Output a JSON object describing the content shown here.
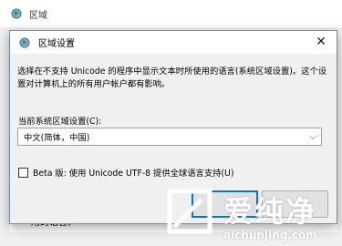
{
  "background_window": {
    "title": "区域",
    "footer_text": "用的语言。"
  },
  "dialog": {
    "title": "区域设置",
    "close_icon": "close-icon",
    "description": "选择在不支持 Unicode 的程序中显示文本时所使用的语言(系统区域设置)。这个设置对计算机上的所有用户帐户都有影响。",
    "current_locale_label": "当前系统区域设置(C):",
    "current_locale_value": "中文(简体，中国)",
    "beta_checkbox_label": "Beta 版: 使用 Unicode UTF-8 提供全球语言支持(U)",
    "beta_checkbox_checked": false
  },
  "watermark": {
    "title": "爱纯净",
    "url": "aichunjing.com"
  },
  "colors": {
    "accent": "#0078d7",
    "dialog_body": "#f0f0f0",
    "border": "#a0a0a0"
  }
}
